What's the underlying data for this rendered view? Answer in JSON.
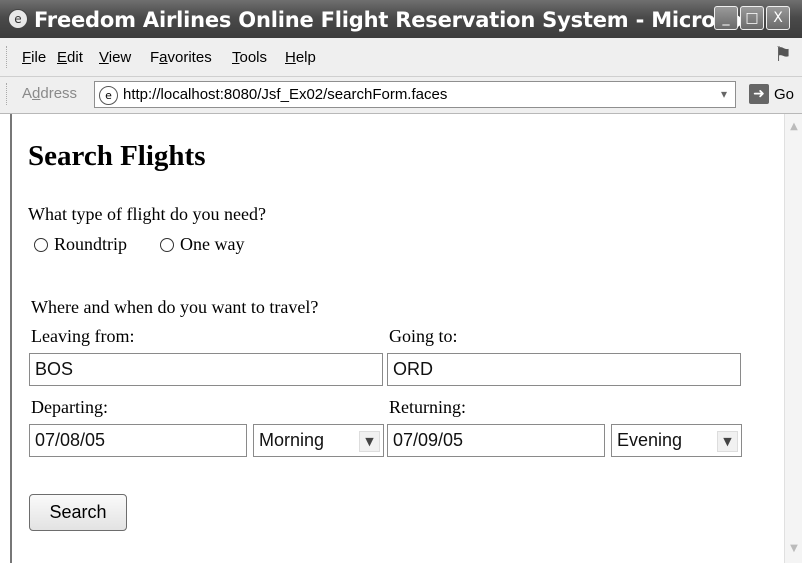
{
  "window": {
    "title": "Freedom Airlines Online Flight Reservation System - Microsoft ...",
    "controls": {
      "minimize": "_",
      "maximize": "□",
      "close": "X"
    }
  },
  "menu": {
    "items": [
      {
        "label": "File",
        "access_key": "F",
        "rest": "ile"
      },
      {
        "label": "Edit",
        "access_key": "E",
        "rest": "dit"
      },
      {
        "label": "View",
        "access_key": "V",
        "rest": "iew"
      },
      {
        "label": "Favorites",
        "pre": "F",
        "access_key": "a",
        "rest": "vorites"
      },
      {
        "label": "Tools",
        "access_key": "T",
        "rest": "ools"
      },
      {
        "label": "Help",
        "access_key": "H",
        "rest": "elp"
      }
    ]
  },
  "address_bar": {
    "label_pre": "A",
    "label_key": "d",
    "label_rest": "dress",
    "url": "http://localhost:8080/Jsf_Ex02/searchForm.faces",
    "go_label": "Go"
  },
  "form": {
    "heading": "Search Flights",
    "flight_type_question": "What type of flight do you need?",
    "flight_types": [
      "Roundtrip",
      "One way"
    ],
    "travel_question": "Where and when do you want to travel?",
    "leaving_from_label": "Leaving from:",
    "leaving_from_value": "BOS",
    "going_to_label": "Going to:",
    "going_to_value": "ORD",
    "departing_label": "Departing:",
    "departing_date": "07/08/05",
    "departing_time": "Morning",
    "returning_label": "Returning:",
    "returning_date": "07/09/05",
    "returning_time": "Evening",
    "search_button": "Search"
  },
  "icons": {
    "app": "ie-logo-icon",
    "page": "page-icon",
    "go": "go-arrow-icon"
  }
}
